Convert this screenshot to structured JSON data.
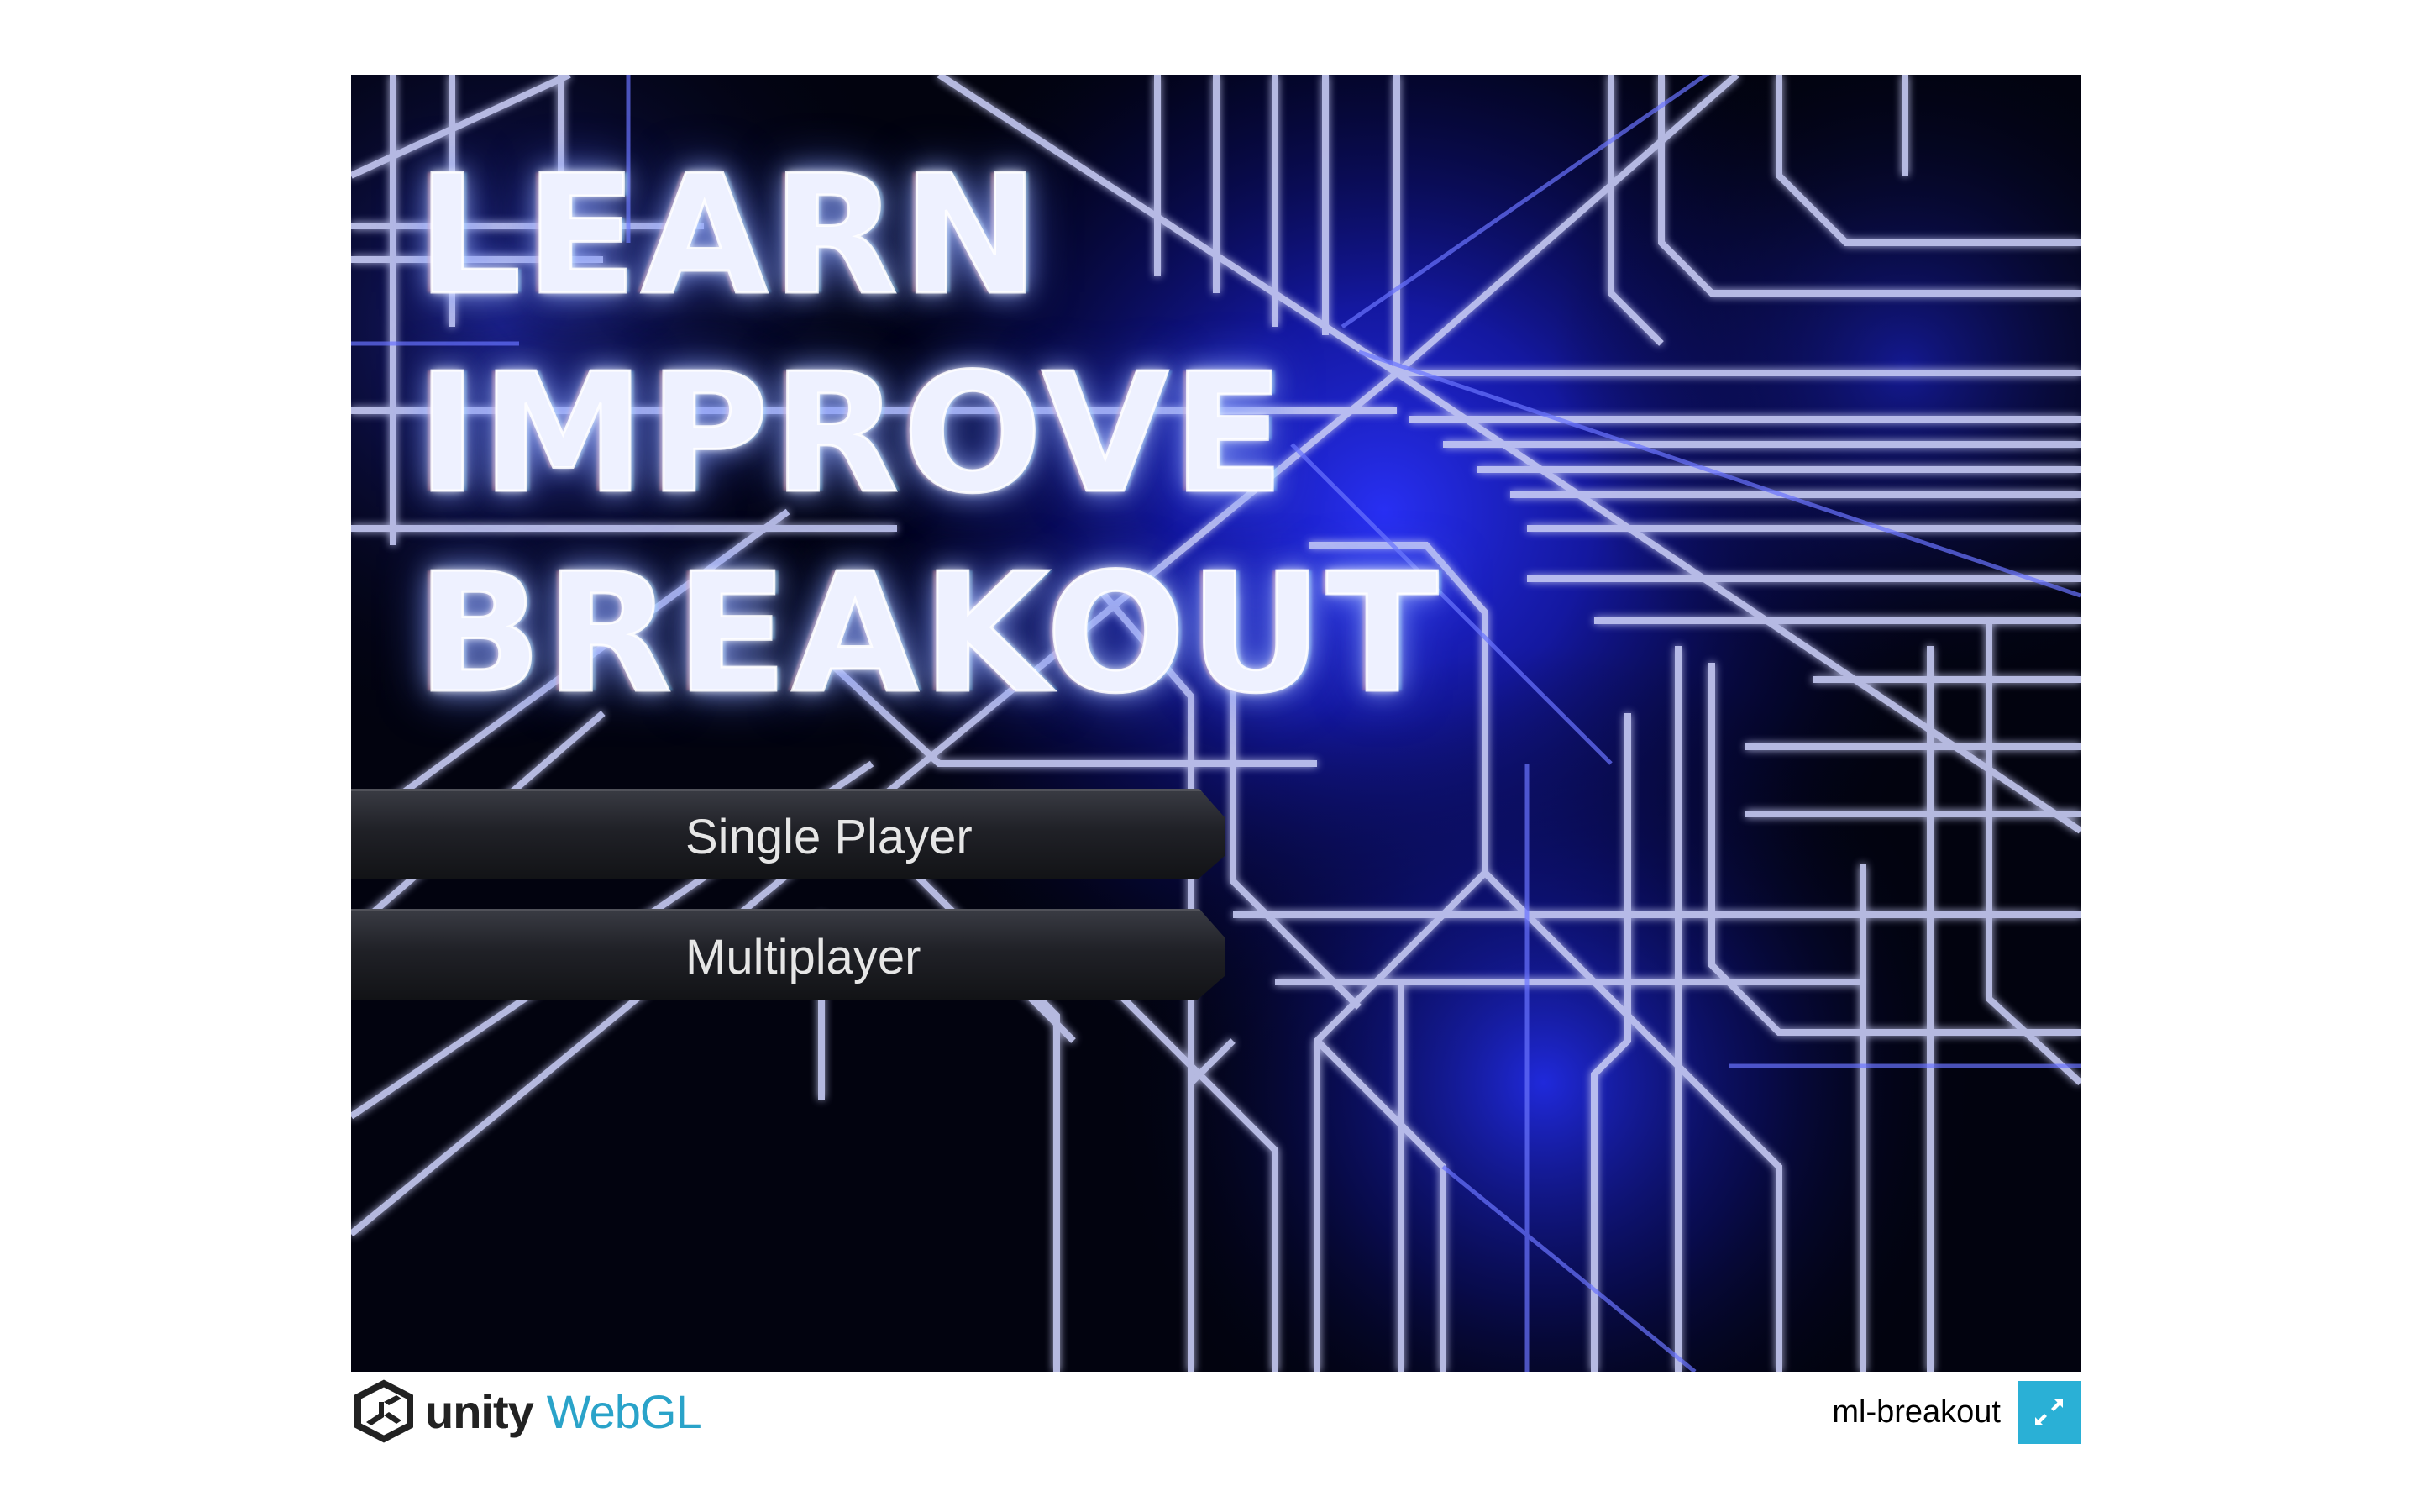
{
  "game": {
    "title_lines": [
      "LEARN",
      "IMPROVE",
      "BREAKOUT"
    ],
    "menu": [
      {
        "label": "Single Player"
      },
      {
        "label": "Multiplayer"
      }
    ]
  },
  "footer": {
    "logo_unity": "unity",
    "logo_webgl": "WebGL",
    "project_name": "ml-breakout",
    "fullscreen_icon": "fullscreen-icon"
  },
  "colors": {
    "background": "#ffffff",
    "canvas_bg": "#02030f",
    "neon_blue": "#3b44ff",
    "webgl_accent": "#2aa3c9",
    "fullscreen_button": "#2ab0d6"
  }
}
